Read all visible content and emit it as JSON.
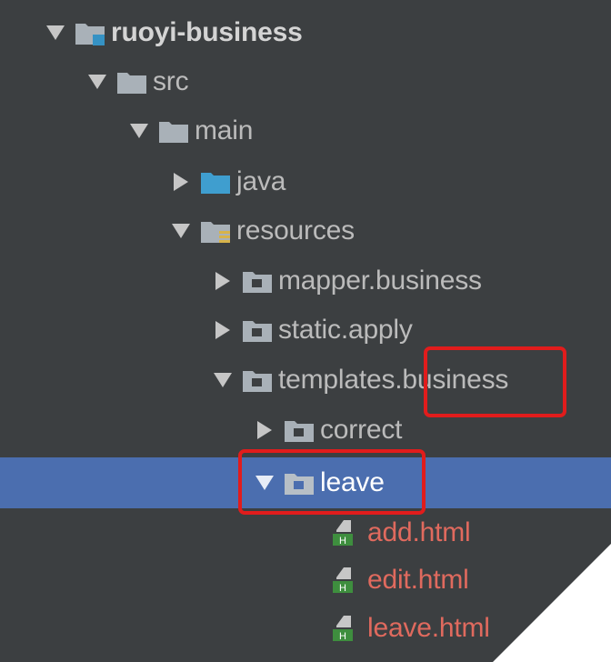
{
  "tree": {
    "nodes": [
      {
        "label": "ruoyi-business",
        "expanded": true,
        "icon": "module-folder-icon"
      },
      {
        "label": "src",
        "expanded": true,
        "icon": "folder-icon"
      },
      {
        "label": "main",
        "expanded": true,
        "icon": "folder-icon"
      },
      {
        "label": "java",
        "expanded": false,
        "icon": "source-root-folder-icon"
      },
      {
        "label": "resources",
        "expanded": true,
        "icon": "resources-folder-icon"
      },
      {
        "label": "mapper.business",
        "expanded": false,
        "icon": "package-folder-icon"
      },
      {
        "label": "static.apply",
        "expanded": false,
        "icon": "package-folder-icon"
      },
      {
        "label": "templates.business",
        "expanded": true,
        "icon": "package-folder-icon"
      },
      {
        "label": "correct",
        "expanded": false,
        "icon": "package-folder-icon"
      },
      {
        "label": "leave",
        "expanded": true,
        "selected": true,
        "icon": "package-folder-icon"
      },
      {
        "label": "add.html",
        "icon": "html-file-icon"
      },
      {
        "label": "edit.html",
        "icon": "html-file-icon"
      },
      {
        "label": "leave.html",
        "icon": "html-file-icon"
      }
    ]
  },
  "colors": {
    "background": "#3c3f41",
    "selection": "#4b6eaf",
    "text": "#bbbbbb",
    "file_text": "#e06a5e",
    "highlight_box": "#e11c1c"
  }
}
